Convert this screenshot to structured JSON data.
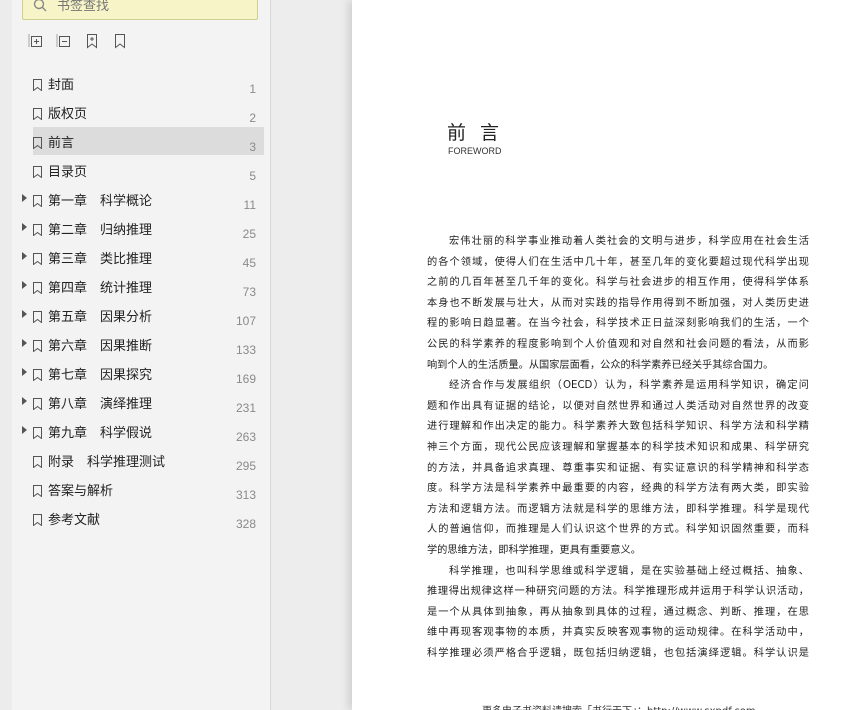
{
  "sidebar": {
    "search_placeholder": "书签查找",
    "bookmarks": [
      {
        "label": "封面",
        "page": "1",
        "expandable": false,
        "selected": false
      },
      {
        "label": "版权页",
        "page": "2",
        "expandable": false,
        "selected": false
      },
      {
        "label": "前言",
        "page": "3",
        "expandable": false,
        "selected": true
      },
      {
        "label": "目录页",
        "page": "5",
        "expandable": false,
        "selected": false
      },
      {
        "label": "第一章　科学概论",
        "page": "11",
        "expandable": true,
        "selected": false
      },
      {
        "label": "第二章　归纳推理",
        "page": "25",
        "expandable": true,
        "selected": false
      },
      {
        "label": "第三章　类比推理",
        "page": "45",
        "expandable": true,
        "selected": false
      },
      {
        "label": "第四章　统计推理",
        "page": "73",
        "expandable": true,
        "selected": false
      },
      {
        "label": "第五章　因果分析",
        "page": "107",
        "expandable": true,
        "selected": false
      },
      {
        "label": "第六章　因果推断",
        "page": "133",
        "expandable": true,
        "selected": false
      },
      {
        "label": "第七章　因果探究",
        "page": "169",
        "expandable": true,
        "selected": false
      },
      {
        "label": "第八章　演绎推理",
        "page": "231",
        "expandable": true,
        "selected": false
      },
      {
        "label": "第九章　科学假说",
        "page": "263",
        "expandable": true,
        "selected": false
      },
      {
        "label": "附录　科学推理测试",
        "page": "295",
        "expandable": false,
        "selected": false
      },
      {
        "label": "答案与解析",
        "page": "313",
        "expandable": false,
        "selected": false
      },
      {
        "label": "参考文献",
        "page": "328",
        "expandable": false,
        "selected": false
      }
    ]
  },
  "document": {
    "title": "前 言",
    "subtitle": "FOREWORD",
    "lines": [
      "宏伟壮丽的科学事业推动着人类社会的文明与进步，科学应用在社会生活",
      "的各个领域，使得人们在生活中几十年，甚至几年的变化要超过现代科学出现",
      "之前的几百年甚至几千年的变化。科学与社会进步的相互作用，使得科学体系",
      "本身也不断发展与壮大，从而对实践的指导作用得到不断加强，对人类历史进",
      "程的影响日趋显著。在当今社会，科学技术正日益深刻影响我们的生活，一个",
      "公民的科学素养的程度影响到个人价值观和对自然和社会问题的看法，从而影",
      "响到个人的生活质量。从国家层面看，公众的科学素养已经关乎其综合国力。",
      "经济合作与发展组织（OECD）认为，科学素养是运用科学知识，确定问",
      "题和作出具有证据的结论，以便对自然世界和通过人类活动对自然世界的改变",
      "进行理解和作出决定的能力。科学素养大致包括科学知识、科学方法和科学精",
      "神三个方面，现代公民应该理解和掌握基本的科学技术知识和成果、科学研究",
      "的方法，并具备追求真理、尊重事实和证据、有实证意识的科学精神和科学态",
      "度。科学方法是科学素养中最重要的内容，经典的科学方法有两大类，即实验",
      "方法和逻辑方法。而逻辑方法就是科学的思维方法，即科学推理。科学是现代",
      "人的普遍信仰，而推理是人们认识这个世界的方式。科学知识固然重要，而科",
      "学的思维方法，即科学推理，更具有重要意义。",
      "科学推理，也叫科学思维或科学逻辑，是在实验基础上经过概括、抽象、",
      "推理得出规律这样一种研究问题的方法。科学推理形成并运用于科学认识活动，",
      "是一个从具体到抽象，再从抽象到具体的过程，通过概念、判断、推理，在思",
      "维中再现客观事物的本质，并真实反映客观事物的运动规律。在科学活动中，",
      "科学推理必须严格合乎逻辑，既包括归纳逻辑，也包括演绎逻辑。科学认识是"
    ],
    "footer": "更多电子书资料请搜索「书行天下」：http://www.sxpdf.com"
  }
}
